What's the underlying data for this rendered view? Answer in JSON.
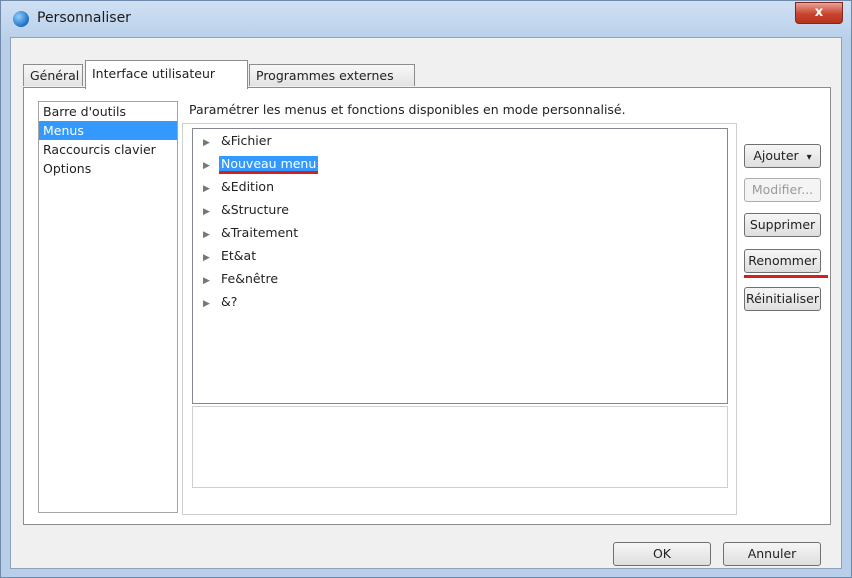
{
  "window": {
    "title": "Personnaliser",
    "close_label": "x"
  },
  "tabs": [
    {
      "label": "Général",
      "active": false
    },
    {
      "label": "Interface utilisateur",
      "active": true
    },
    {
      "label": "Programmes externes",
      "active": false
    }
  ],
  "sidebar": {
    "items": [
      {
        "label": "Barre d'outils",
        "selected": false
      },
      {
        "label": "Menus",
        "selected": true
      },
      {
        "label": "Raccourcis clavier",
        "selected": false
      },
      {
        "label": "Options",
        "selected": false
      }
    ]
  },
  "main": {
    "description": "Paramétrer les menus et fonctions disponibles en mode personnalisé.",
    "tree_items": [
      {
        "label": "&Fichier",
        "selected": false
      },
      {
        "label": "Nouveau menu",
        "selected": true
      },
      {
        "label": "&Edition",
        "selected": false
      },
      {
        "label": "&Structure",
        "selected": false
      },
      {
        "label": "&Traitement",
        "selected": false
      },
      {
        "label": "Et&at",
        "selected": false
      },
      {
        "label": "Fe&nêtre",
        "selected": false
      },
      {
        "label": "&?",
        "selected": false
      }
    ]
  },
  "actions": {
    "add_label": "Ajouter",
    "add_arrow": "▾",
    "modify_label": "Modifier...",
    "delete_label": "Supprimer",
    "rename_label": "Renommer",
    "reset_label": "Réinitialiser"
  },
  "footer": {
    "ok_label": "OK",
    "cancel_label": "Annuler"
  },
  "colors": {
    "selection": "#3399ff",
    "highlight_underline": "#d32020"
  }
}
